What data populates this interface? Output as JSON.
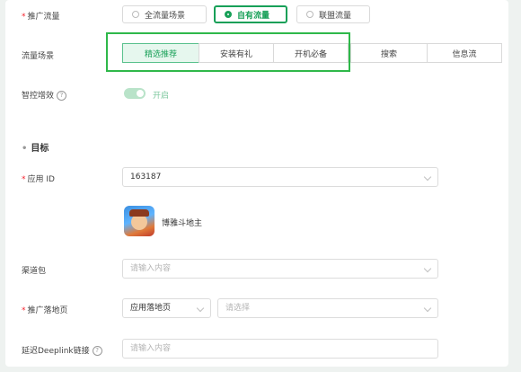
{
  "promotion_traffic": {
    "label": "推广流量",
    "options": [
      "全流量场景",
      "自有流量",
      "联盟流量"
    ],
    "selected": "自有流量"
  },
  "traffic_scene": {
    "label": "流量场景",
    "options": [
      "精选推荐",
      "安装有礼",
      "开机必备",
      "搜索",
      "信息流"
    ],
    "selected": "精选推荐"
  },
  "smart_boost": {
    "label": "智控增效",
    "state_label": "开启",
    "enabled": true
  },
  "target_section": {
    "title": "目标"
  },
  "app_id": {
    "label": "应用 ID",
    "value": "163187",
    "app_name": "博雅斗地主"
  },
  "channel_package": {
    "label": "渠道包",
    "placeholder": "请输入内容"
  },
  "landing_page": {
    "label": "推广落地页",
    "type_value": "应用落地页",
    "placeholder": "请选择"
  },
  "deeplink": {
    "label": "延迟Deeplink链接",
    "placeholder": "请输入内容"
  },
  "colors": {
    "accent": "#18a058",
    "highlight": "#2fb84a",
    "required": "#f5222d"
  }
}
